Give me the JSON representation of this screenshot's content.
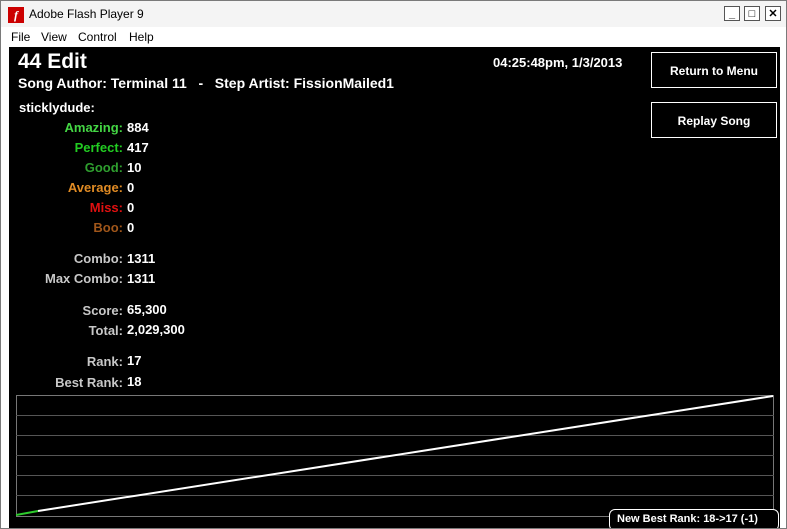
{
  "window": {
    "title": "Adobe Flash Player 9",
    "minimize": "_",
    "maximize": "□",
    "close": "✕",
    "icon": "flash-icon"
  },
  "menu": [
    "File",
    "View",
    "Control",
    "Help"
  ],
  "header": {
    "title": "44 Edit",
    "meta": "Song Author: Terminal 11   -   Step Artist: FissionMailed1",
    "timestamp": "04:25:48pm, 1/3/2013"
  },
  "buttons": {
    "return": "Return to Menu",
    "replay": "Replay Song"
  },
  "player": "sticklydude:",
  "judgements": [
    {
      "label": "Amazing:",
      "value": "884",
      "color": "#44d644"
    },
    {
      "label": "Perfect:",
      "value": "417",
      "color": "#22cc22"
    },
    {
      "label": "Good:",
      "value": "10",
      "color": "#2f9f2f"
    },
    {
      "label": "Average:",
      "value": "0",
      "color": "#e08b24"
    },
    {
      "label": "Miss:",
      "value": "0",
      "color": "#e01010"
    },
    {
      "label": "Boo:",
      "value": "0",
      "color": "#a0561a"
    }
  ],
  "combo": [
    {
      "label": "Combo:",
      "value": "1311"
    },
    {
      "label": "Max Combo:",
      "value": "1311"
    }
  ],
  "score": [
    {
      "label": "Score:",
      "value": "65,300"
    },
    {
      "label": "Total:",
      "value": "2,029,300"
    }
  ],
  "rank": [
    {
      "label": "Rank:",
      "value": "17"
    },
    {
      "label": "Best Rank:",
      "value": "18"
    }
  ],
  "label_color": "#c8c8c8",
  "graph_progress": 1.0,
  "banner": "New Best Rank: 18->17 (-1)"
}
